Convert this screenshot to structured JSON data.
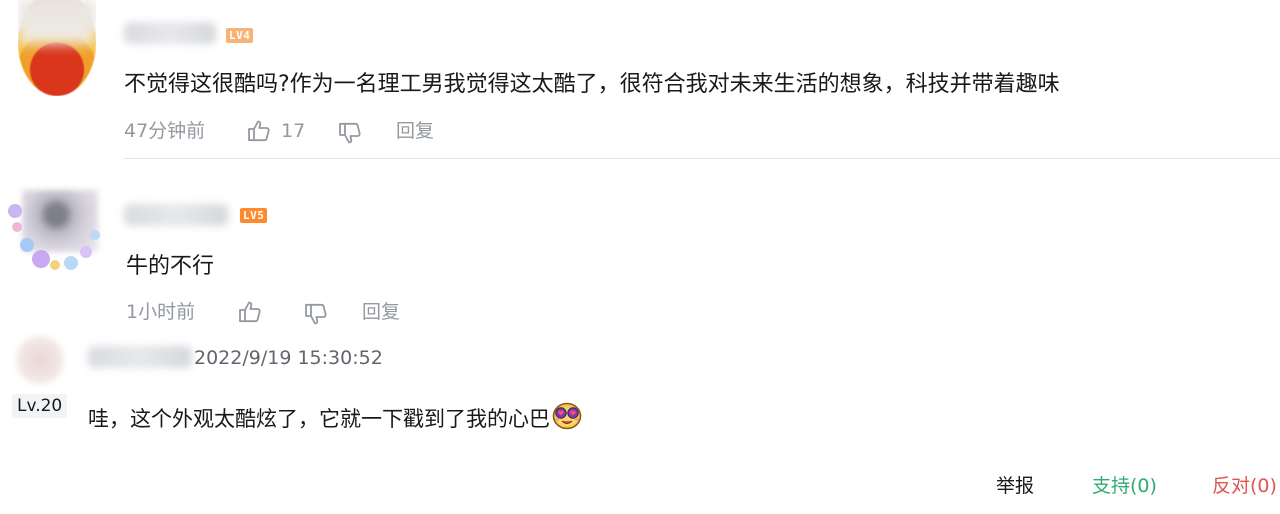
{
  "comments": [
    {
      "level_badge": "LV4",
      "text": "不觉得这很酷吗?作为一名理工男我觉得这太酷了，很符合我对未来生活的想象，科技并带着趣味",
      "time": "47分钟前",
      "like_count": "17",
      "reply_label": "回复"
    },
    {
      "level_badge": "LV5",
      "text": "牛的不行",
      "time": "1小时前",
      "like_count": "",
      "reply_label": "回复"
    },
    {
      "level_badge": "Lv.20",
      "date": "2022/9/19 15:30:52",
      "text": "哇，这个外观太酷炫了，它就一下戳到了我的心巴"
    }
  ],
  "footer_actions": {
    "report": "举报",
    "support": "支持(0)",
    "oppose": "反对(0)"
  },
  "colors": {
    "meta_gray": "#9499a0",
    "support_green": "#2faa74",
    "oppose_red": "#e2554f",
    "lv4_badge": "#f7b376",
    "lv5_badge": "#ff8a2b"
  },
  "icons": [
    "thumb-up-icon",
    "thumb-down-icon",
    "emoji-heart-eyes-icon"
  ]
}
